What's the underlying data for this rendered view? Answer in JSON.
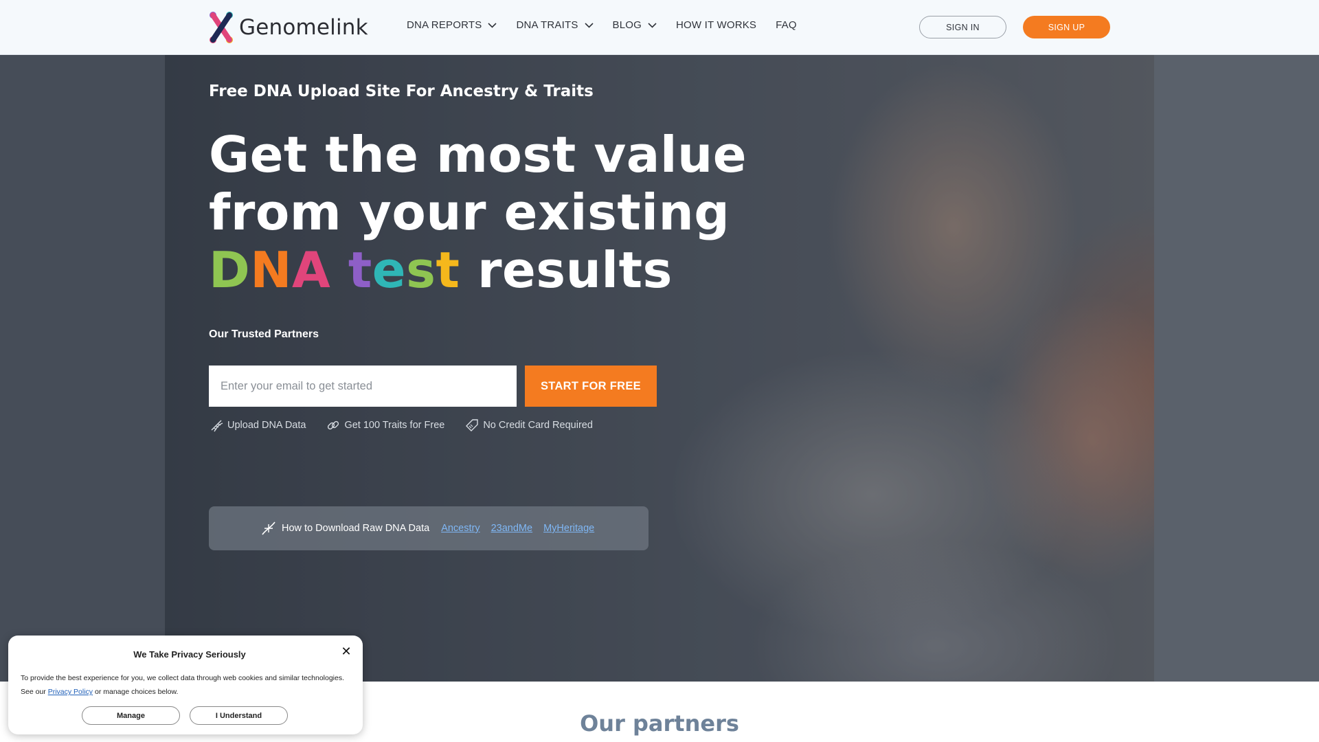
{
  "header": {
    "logo_text": "Genomelink",
    "nav": [
      {
        "label": "DNA REPORTS",
        "has_dropdown": true
      },
      {
        "label": "DNA TRAITS",
        "has_dropdown": true
      },
      {
        "label": "BLOG",
        "has_dropdown": true
      },
      {
        "label": "HOW IT WORKS",
        "has_dropdown": false
      },
      {
        "label": "FAQ",
        "has_dropdown": false
      }
    ],
    "signin_label": "SIGN IN",
    "signup_label": "SIGN UP"
  },
  "hero": {
    "subtitle": "Free DNA Upload Site For Ancestry & Traits",
    "title_line1": "Get the most value",
    "title_line2": "from your existing",
    "title_line3": {
      "dna_letters": [
        "D",
        "N",
        "A"
      ],
      "test_letters": [
        "t",
        "e",
        "s",
        "t"
      ],
      "rest": "results"
    },
    "partners_label": "Our Trusted Partners",
    "email_placeholder": "Enter your email to get started",
    "start_button": "START FOR FREE",
    "features": [
      {
        "icon": "dna-icon",
        "label": "Upload DNA Data"
      },
      {
        "icon": "dna-link-icon",
        "label": "Get 100 Traits for Free"
      },
      {
        "icon": "tag-icon",
        "label": "No Credit Card Required"
      }
    ],
    "download_bar": {
      "icon": "dna-strand-icon",
      "text": "How to Download Raw DNA Data",
      "links": [
        "Ancestry",
        "23andMe",
        "MyHeritage"
      ]
    }
  },
  "partners_section": {
    "heading": "Our partners"
  },
  "cookie_banner": {
    "title": "We Take Privacy Seriously",
    "body_before": "To provide the best experience for you, we collect data through web cookies and similar technologies. See our ",
    "privacy_link": "Privacy Policy",
    "body_after": " or manage choices below.",
    "manage_label": "Manage",
    "understand_label": "I Understand",
    "close_symbol": "✕"
  },
  "colors": {
    "brand_orange": "#f47b20",
    "link_blue": "#7fb7f5",
    "dna_green": "#8fc552",
    "dna_orange": "#f47b20",
    "dna_pink": "#e0457b",
    "test_purple": "#8e5fc7",
    "test_teal": "#2fb6b6",
    "test_green": "#8fc552",
    "test_yellow": "#f5b81c"
  }
}
